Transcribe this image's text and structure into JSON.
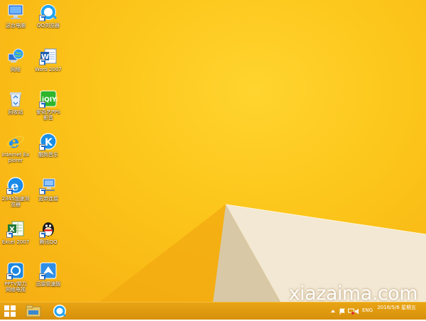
{
  "desktop_icons": [
    {
      "id": "computer",
      "label": "这台电脑",
      "icon": "computer-icon"
    },
    {
      "id": "qq-browser",
      "label": "QQ浏览器",
      "icon": "qq-browser-icon"
    },
    {
      "id": "network",
      "label": "网络",
      "icon": "network-globe-icon"
    },
    {
      "id": "word",
      "label": "Word 2007",
      "icon": "word-icon"
    },
    {
      "id": "recycle",
      "label": "回收站",
      "icon": "recycle-bin-icon"
    },
    {
      "id": "iqiyi",
      "label": "爱奇艺PPS 影音",
      "icon": "iqiyi-icon"
    },
    {
      "id": "ie",
      "label": "Internet Explorer",
      "icon": "internet-explorer-icon"
    },
    {
      "id": "kugou",
      "label": "酷狗音乐",
      "icon": "kugou-icon"
    },
    {
      "id": "browser-2345",
      "label": "2345加速浏览器",
      "icon": "browser-2345-icon"
    },
    {
      "id": "broadband",
      "label": "宽带连接",
      "icon": "broadband-connection-icon"
    },
    {
      "id": "excel",
      "label": "Excel 2007",
      "icon": "excel-icon"
    },
    {
      "id": "qq",
      "label": "腾讯QQ",
      "icon": "qq-penguin-icon"
    },
    {
      "id": "pptv",
      "label": "PPTV聚力 网络电视",
      "icon": "pptv-icon"
    },
    {
      "id": "xunlei",
      "label": "迅雷极速版",
      "icon": "xunlei-icon"
    }
  ],
  "watermark": "xiazaima.com",
  "taskbar": {
    "items": [
      {
        "id": "start",
        "icon": "windows-start-icon"
      },
      {
        "id": "explorer",
        "icon": "file-explorer-icon"
      },
      {
        "id": "qq-browser",
        "icon": "qq-browser-icon"
      }
    ],
    "tray": {
      "ime": "ENG",
      "time": "",
      "date": "2016/5/6 星期五",
      "icons": [
        "chevron-up-icon",
        "flag-icon",
        "network-icon",
        "volume-icon"
      ]
    }
  },
  "colors": {
    "wallpaper": "#fcc51a",
    "taskbar": "#dd970e",
    "label": "#ffffff"
  }
}
